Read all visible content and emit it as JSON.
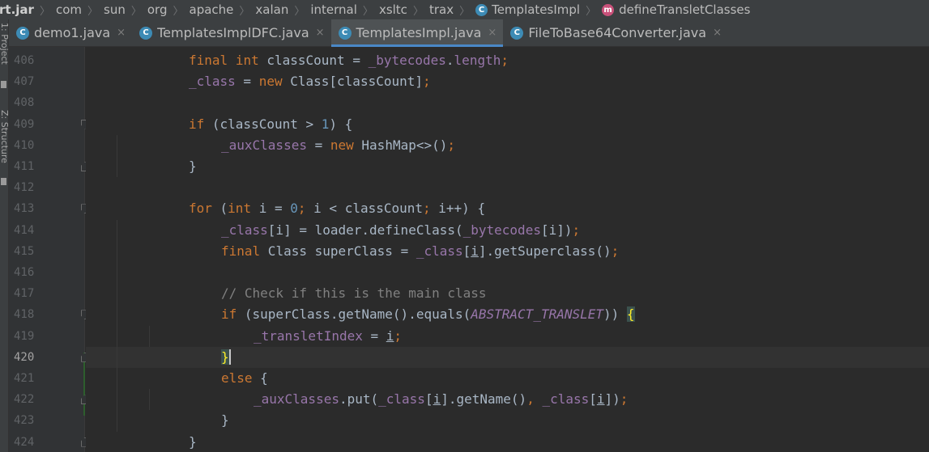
{
  "breadcrumb": {
    "items": [
      "rt.jar",
      "com",
      "sun",
      "org",
      "apache",
      "xalan",
      "internal",
      "xsltc",
      "trax",
      "TemplatesImpl",
      "defineTransletClasses"
    ],
    "class_icon": "C",
    "method_icon": "m"
  },
  "toolstrip": {
    "project_label": "1: Project",
    "structure_label": "Z: Structure"
  },
  "tabs": [
    {
      "label": "demo1.java",
      "close": "×",
      "icon": "C"
    },
    {
      "label": "TemplatesImplDFC.java",
      "close": "×",
      "icon": "C"
    },
    {
      "label": "TemplatesImpl.java",
      "close": "×",
      "icon": "C",
      "active": true
    },
    {
      "label": "FileToBase64Converter.java",
      "close": "×",
      "icon": "C"
    }
  ],
  "editor": {
    "line_numbers": [
      "406",
      "407",
      "408",
      "409",
      "410",
      "411",
      "412",
      "413",
      "414",
      "415",
      "416",
      "417",
      "418",
      "419",
      "420",
      "421",
      "422",
      "423",
      "424"
    ],
    "current_line": "420",
    "lines": [
      [
        {
          "t": "final",
          "c": "kw"
        },
        {
          "t": " "
        },
        {
          "t": "int",
          "c": "kw"
        },
        {
          "t": " classCount = "
        },
        {
          "t": "_bytecodes",
          "c": "fld"
        },
        {
          "t": "."
        },
        {
          "t": "length",
          "c": "fld"
        },
        {
          "t": ";",
          "c": "kw"
        }
      ],
      [
        {
          "t": "_class",
          "c": "fld"
        },
        {
          "t": " = "
        },
        {
          "t": "new",
          "c": "kw"
        },
        {
          "t": " Class[classCount]"
        },
        {
          "t": ";",
          "c": "kw"
        }
      ],
      [],
      [
        {
          "t": "if",
          "c": "kw"
        },
        {
          "t": " (classCount > "
        },
        {
          "t": "1",
          "c": "num"
        },
        {
          "t": ") {"
        }
      ],
      [
        {
          "t": "_auxClasses",
          "c": "fld"
        },
        {
          "t": " = "
        },
        {
          "t": "new",
          "c": "kw"
        },
        {
          "t": " HashMap<>()"
        },
        {
          "t": ";",
          "c": "kw"
        }
      ],
      [
        {
          "t": "}"
        }
      ],
      [],
      [
        {
          "t": "for",
          "c": "kw"
        },
        {
          "t": " ("
        },
        {
          "t": "int",
          "c": "kw"
        },
        {
          "t": " i = "
        },
        {
          "t": "0",
          "c": "num"
        },
        {
          "t": "; ",
          "c": "kw"
        },
        {
          "t": "i < classCount"
        },
        {
          "t": "; ",
          "c": "kw"
        },
        {
          "t": "i++) {"
        }
      ],
      [
        {
          "t": "_class",
          "c": "fld"
        },
        {
          "t": "[i] = loader.defineClass("
        },
        {
          "t": "_bytecodes",
          "c": "fld"
        },
        {
          "t": "[i])"
        },
        {
          "t": ";",
          "c": "kw"
        }
      ],
      [
        {
          "t": "final",
          "c": "kw"
        },
        {
          "t": " Class superClass = "
        },
        {
          "t": "_class",
          "c": "fld"
        },
        {
          "t": "["
        },
        {
          "t": "i",
          "c": "und"
        },
        {
          "t": "].getSuperclass()"
        },
        {
          "t": ";",
          "c": "kw"
        }
      ],
      [],
      [
        {
          "t": "// Check if this is the main class",
          "c": "cmt"
        }
      ],
      [
        {
          "t": "if",
          "c": "kw"
        },
        {
          "t": " (superClass.getName().equals("
        },
        {
          "t": "ABSTRACT_TRANSLET",
          "c": "cst"
        },
        {
          "t": ")) "
        },
        {
          "t": "{",
          "c": "brhl"
        }
      ],
      [
        {
          "t": "_transletIndex",
          "c": "fld"
        },
        {
          "t": " = "
        },
        {
          "t": "i",
          "c": "und"
        },
        {
          "t": ";",
          "c": "kw"
        }
      ],
      [
        {
          "t": "}",
          "c": "brhl"
        },
        {
          "t": "",
          "c": "cursor"
        }
      ],
      [
        {
          "t": "else",
          "c": "kw"
        },
        {
          "t": " {"
        }
      ],
      [
        {
          "t": "_auxClasses",
          "c": "fld"
        },
        {
          "t": ".put("
        },
        {
          "t": "_class",
          "c": "fld"
        },
        {
          "t": "["
        },
        {
          "t": "i",
          "c": "und"
        },
        {
          "t": "].getName()"
        },
        {
          "t": ", ",
          "c": "kw"
        },
        {
          "t": "_class",
          "c": "fld"
        },
        {
          "t": "["
        },
        {
          "t": "i",
          "c": "und"
        },
        {
          "t": "])"
        },
        {
          "t": ";",
          "c": "kw"
        }
      ],
      [
        {
          "t": "}"
        }
      ],
      [
        {
          "t": "}"
        }
      ]
    ]
  }
}
